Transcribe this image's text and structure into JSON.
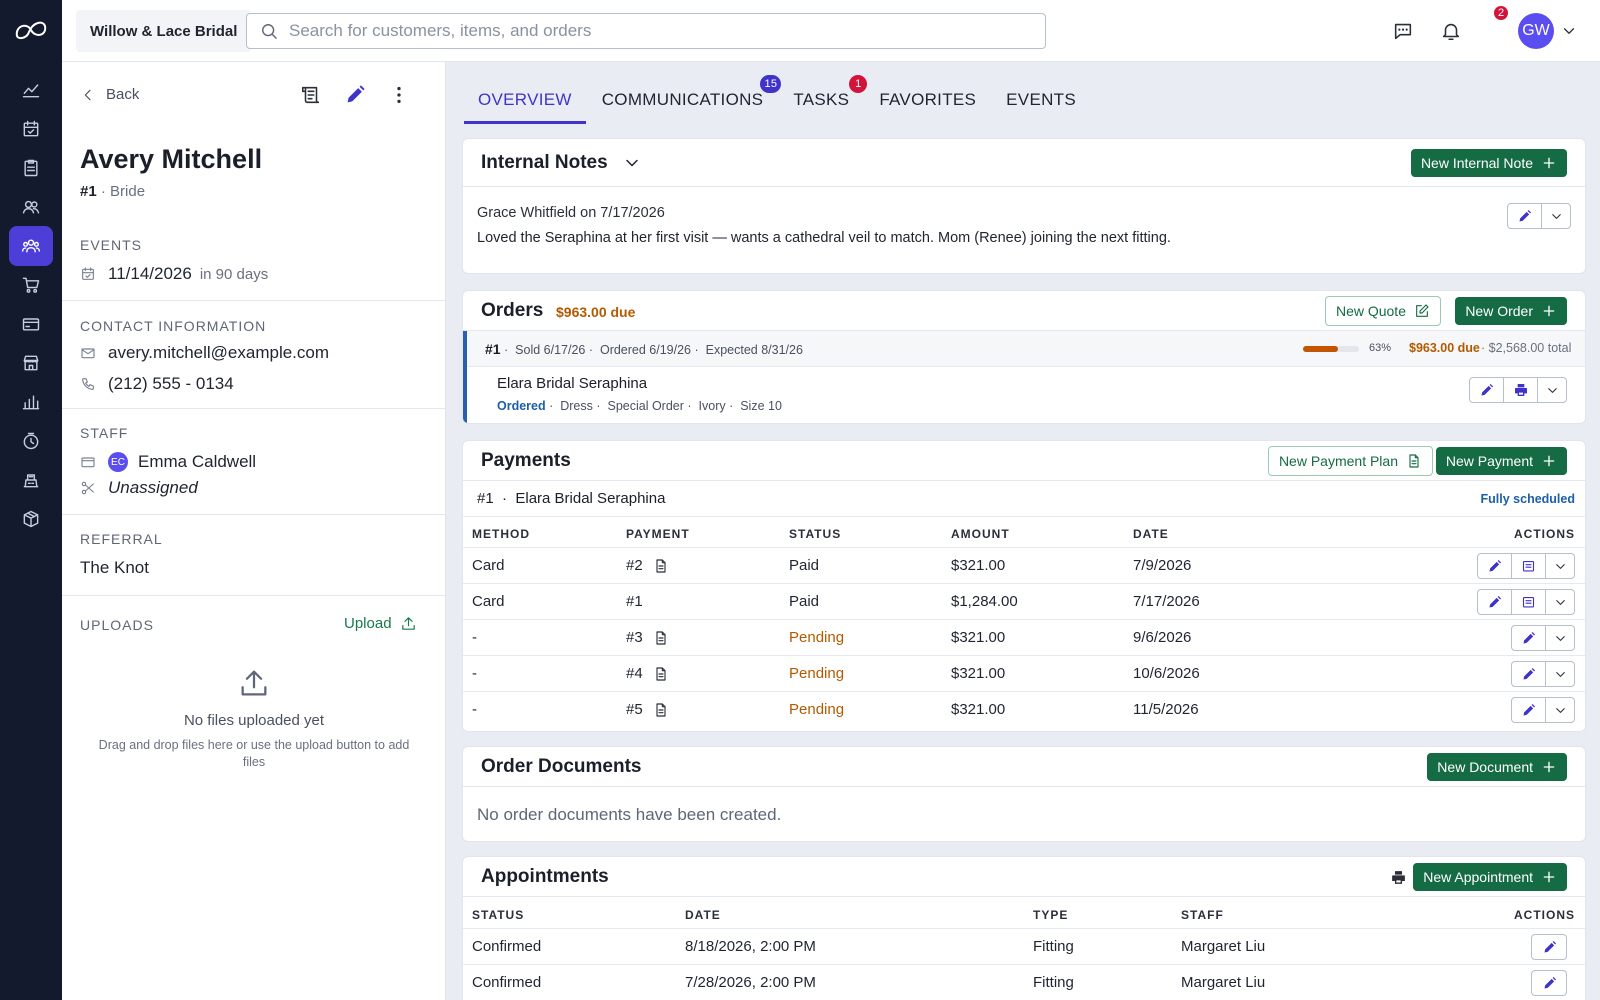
{
  "app": {
    "store_name": "Willow & Lace Bridal",
    "search_placeholder": "Search for customers, items, and orders",
    "notification_count": "2",
    "user_initials": "GW"
  },
  "rail": [
    {
      "name": "rail-analytics",
      "icon": "chart-line-icon"
    },
    {
      "name": "rail-calendar",
      "icon": "calendar-check-icon"
    },
    {
      "name": "rail-tasks",
      "icon": "clipboard-icon"
    },
    {
      "name": "rail-contacts",
      "icon": "users-icon"
    },
    {
      "name": "rail-customers",
      "icon": "customers-icon"
    },
    {
      "name": "rail-cart",
      "icon": "cart-icon"
    },
    {
      "name": "rail-payments",
      "icon": "card-icon"
    },
    {
      "name": "rail-store",
      "icon": "store-icon"
    },
    {
      "name": "rail-reports",
      "icon": "bar-chart-icon"
    },
    {
      "name": "rail-history",
      "icon": "clock-icon"
    },
    {
      "name": "rail-register",
      "icon": "register-icon"
    },
    {
      "name": "rail-inventory",
      "icon": "box-icon"
    }
  ],
  "customer": {
    "back_label": "Back",
    "name": "Avery Mitchell",
    "number": "#1",
    "role": "Bride",
    "events_title": "EVENTS",
    "event_date": "11/14/2026",
    "event_relative": "in 90 days",
    "contact_title": "CONTACT INFORMATION",
    "email": "avery.mitchell@example.com",
    "phone": "(212) 555 - 0134",
    "staff_title": "STAFF",
    "staff_initials": "EC",
    "staff_name": "Emma Caldwell",
    "staff_secondary": "Unassigned",
    "referral_title": "REFERRAL",
    "referral": "The Knot",
    "uploads_title": "UPLOADS",
    "upload_label": "Upload",
    "no_files": "No files uploaded yet",
    "no_files_hint": "Drag and drop files here or use the upload button to add files"
  },
  "tabs": [
    {
      "label": "OVERVIEW",
      "badge": ""
    },
    {
      "label": "COMMUNICATIONS",
      "badge": "15"
    },
    {
      "label": "TASKS",
      "badge": "1"
    },
    {
      "label": "FAVORITES",
      "badge": ""
    },
    {
      "label": "EVENTS",
      "badge": ""
    }
  ],
  "notes": {
    "title": "Internal Notes",
    "new_label": "New Internal Note",
    "author_line": "Grace Whitfield on 7/17/2026",
    "text": "Loved the Seraphina at her first visit — wants a cathedral veil to match. Mom (Renee) joining the next fitting."
  },
  "orders": {
    "title": "Orders",
    "due": "$963.00 due",
    "new_quote_label": "New Quote",
    "new_order_label": "New Order",
    "order_number": "#1",
    "sold": "Sold 6/17/26",
    "ordered": "Ordered 6/19/26",
    "expected": "Expected 8/31/26",
    "progress_pct": 63,
    "progress_label": "63%",
    "order_due": "$963.00 due",
    "order_total": "$2,568.00 total",
    "item_name": "Elara Bridal Seraphina",
    "item_status": "Ordered",
    "item_type": "Dress",
    "item_order_type": "Special Order",
    "item_color": "Ivory",
    "item_size": "Size 10"
  },
  "payments": {
    "title": "Payments",
    "new_plan_label": "New Payment Plan",
    "new_payment_label": "New Payment",
    "group_number": "#1",
    "group_item": "Elara Bridal Seraphina",
    "group_status": "Fully scheduled",
    "columns": [
      "METHOD",
      "PAYMENT",
      "STATUS",
      "AMOUNT",
      "DATE",
      "ACTIONS"
    ],
    "rows": [
      {
        "method": "Card",
        "payment": "#2",
        "doc": true,
        "status": "Paid",
        "amount": "$321.00",
        "date": "7/9/2026",
        "pending": false
      },
      {
        "method": "Card",
        "payment": "#1",
        "doc": false,
        "status": "Paid",
        "amount": "$1,284.00",
        "date": "7/17/2026",
        "pending": false
      },
      {
        "method": "-",
        "payment": "#3",
        "doc": true,
        "status": "Pending",
        "amount": "$321.00",
        "date": "9/6/2026",
        "pending": true
      },
      {
        "method": "-",
        "payment": "#4",
        "doc": true,
        "status": "Pending",
        "amount": "$321.00",
        "date": "10/6/2026",
        "pending": true
      },
      {
        "method": "-",
        "payment": "#5",
        "doc": true,
        "status": "Pending",
        "amount": "$321.00",
        "date": "11/5/2026",
        "pending": true
      }
    ]
  },
  "documents": {
    "title": "Order Documents",
    "new_label": "New Document",
    "empty": "No order documents have been created."
  },
  "appointments": {
    "title": "Appointments",
    "new_label": "New Appointment",
    "columns": [
      "STATUS",
      "DATE",
      "TYPE",
      "STAFF",
      "ACTIONS"
    ],
    "rows": [
      {
        "status": "Confirmed",
        "date": "8/18/2026, 2:00 PM",
        "type": "Fitting",
        "staff": "Margaret Liu"
      },
      {
        "status": "Confirmed",
        "date": "7/28/2026, 2:00 PM",
        "type": "Fitting",
        "staff": "Margaret Liu"
      }
    ]
  },
  "colors": {
    "accent": "#3f33c9",
    "brand_green": "#146b44",
    "warning": "#b35a00",
    "rail": "#131a2e"
  }
}
